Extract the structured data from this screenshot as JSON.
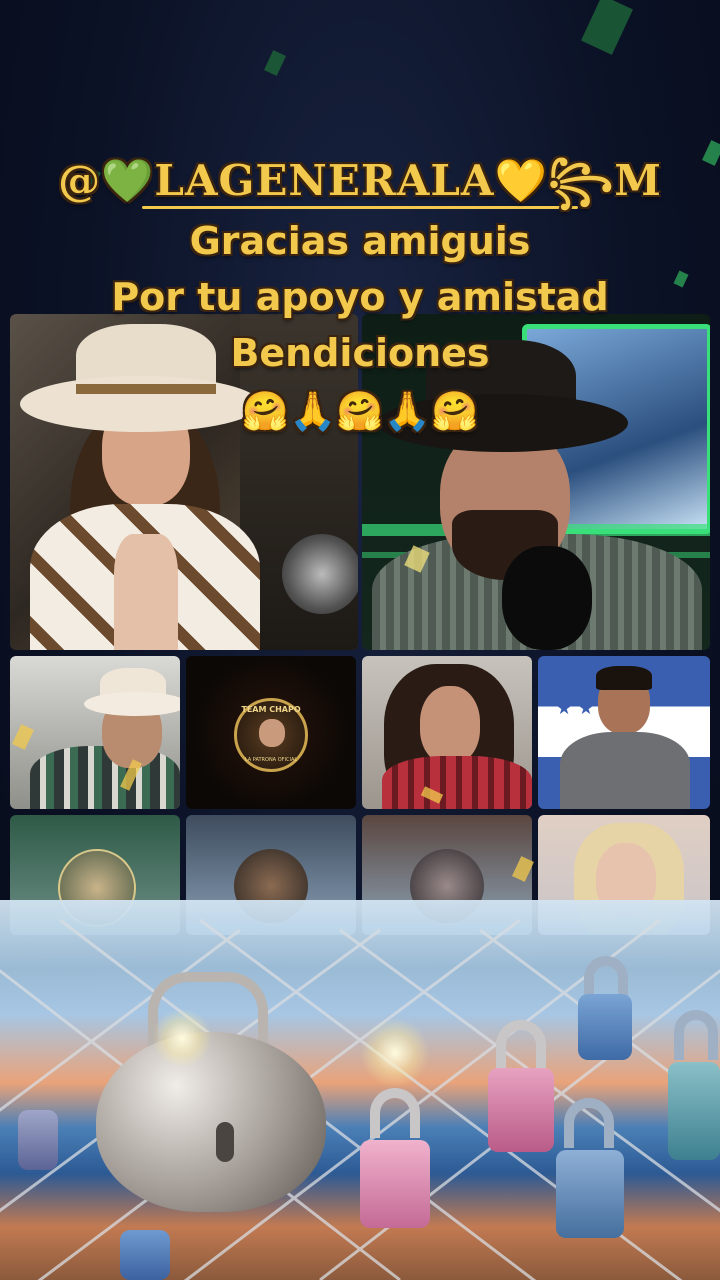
{
  "overlay": {
    "handle": "@💚LAGENERALA💛꧂M",
    "line1": "Gracias amiguis",
    "line2": "Por tu apoyo y amistad",
    "line3": "Bendiciones",
    "emojis": "🤗🙏🤗🙏🤗"
  },
  "badge": {
    "top_text": "TEAM CHAPO",
    "bottom_text": "LA PATRONA OFICIAL"
  },
  "colors": {
    "overlay_text": "#f2c94c",
    "text_outline": "#3a2410",
    "neon_green": "#39e07a",
    "background": "#0b1226"
  },
  "participants": [
    {
      "slot": "main-left",
      "icon": "cowgirl-white-hat"
    },
    {
      "slot": "main-right",
      "icon": "cowboy-black-hat-mic"
    },
    {
      "slot": "small-1",
      "icon": "cowboy-white-hat"
    },
    {
      "slot": "small-2",
      "icon": "team-chapo-badge"
    },
    {
      "slot": "small-3",
      "icon": "woman-curly-hair"
    },
    {
      "slot": "small-4",
      "icon": "man-honduras-flag"
    },
    {
      "slot": "small-5",
      "icon": "avatar-circle"
    },
    {
      "slot": "small-6",
      "icon": "avatar-circle"
    },
    {
      "slot": "small-7",
      "icon": "avatar-circle"
    },
    {
      "slot": "small-8",
      "icon": "woman-blonde"
    }
  ]
}
